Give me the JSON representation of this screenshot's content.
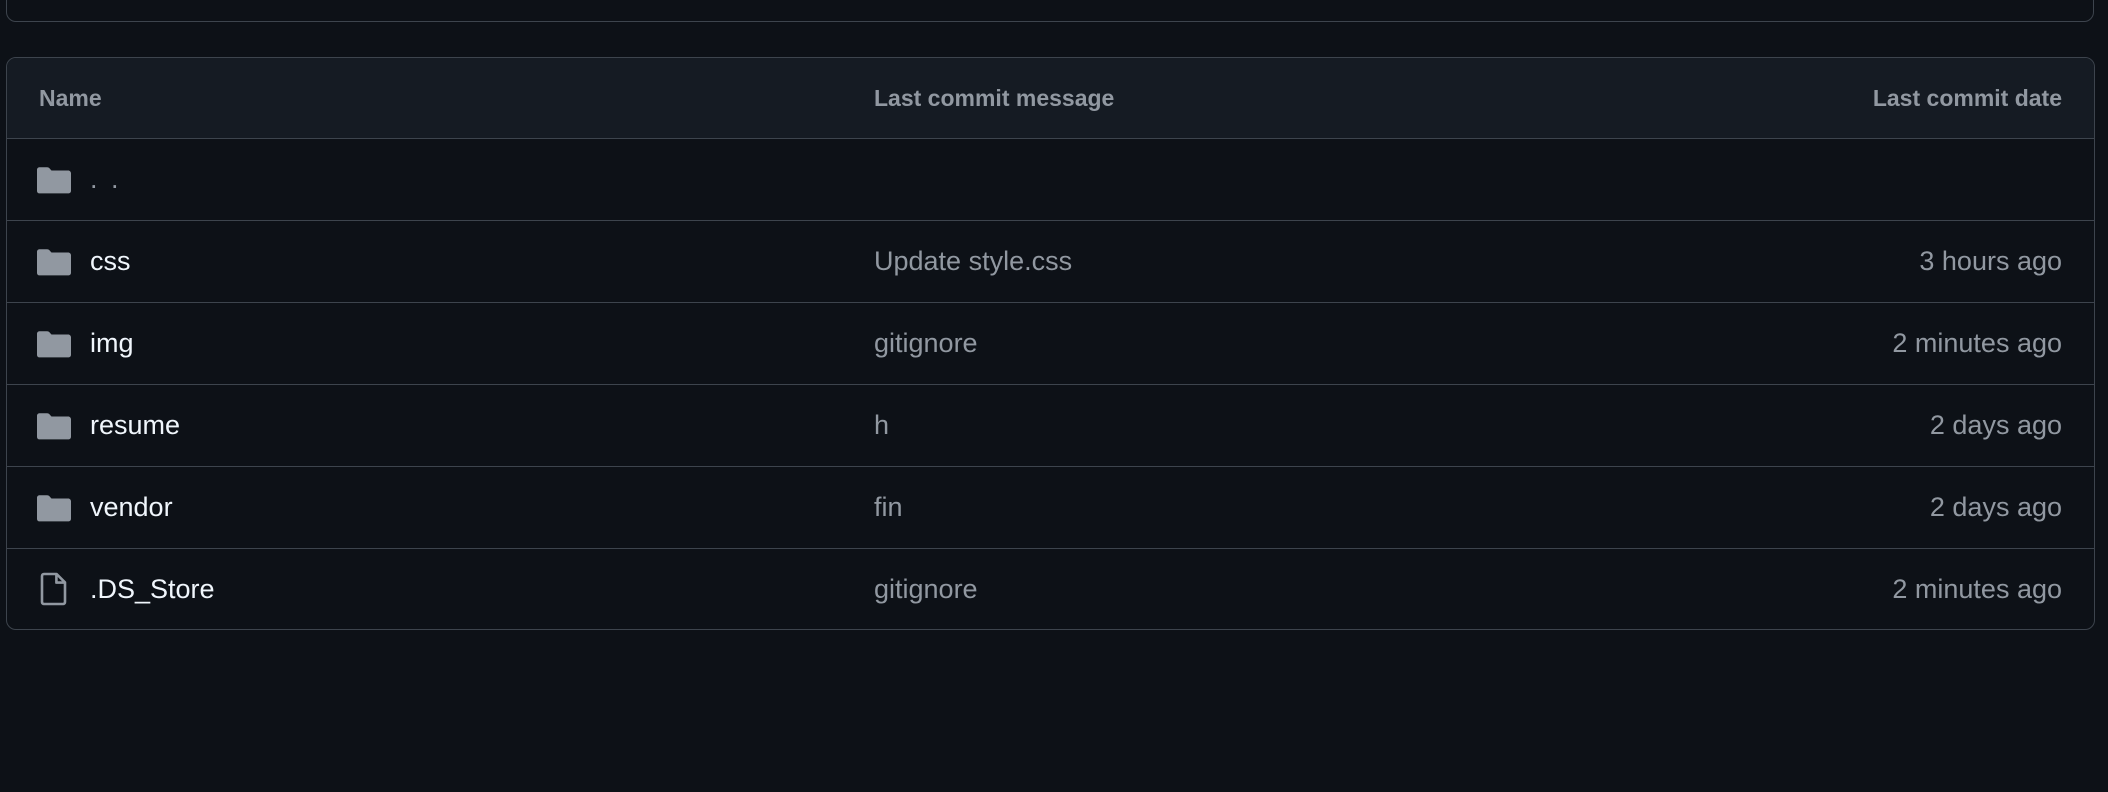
{
  "table": {
    "headers": {
      "name": "Name",
      "message": "Last commit message",
      "date": "Last commit date"
    },
    "parent": {
      "name": ". .",
      "icon": "folder-icon"
    },
    "rows": [
      {
        "name": "css",
        "message": "Update style.css",
        "date": "3 hours ago",
        "icon": "folder-icon"
      },
      {
        "name": "img",
        "message": "gitignore",
        "date": "2 minutes ago",
        "icon": "folder-icon"
      },
      {
        "name": "resume",
        "message": "h",
        "date": "2 days ago",
        "icon": "folder-icon"
      },
      {
        "name": "vendor",
        "message": "fin",
        "date": "2 days ago",
        "icon": "folder-icon"
      },
      {
        "name": ".DS_Store",
        "message": "gitignore",
        "date": "2 minutes ago",
        "icon": "file-icon"
      }
    ]
  },
  "colors": {
    "background": "#0d1117",
    "header_background": "#151b23",
    "border": "#3d444d",
    "muted_text": "#9198a1",
    "primary_text": "#f0f6fc",
    "folder_icon": "#9198a1"
  }
}
